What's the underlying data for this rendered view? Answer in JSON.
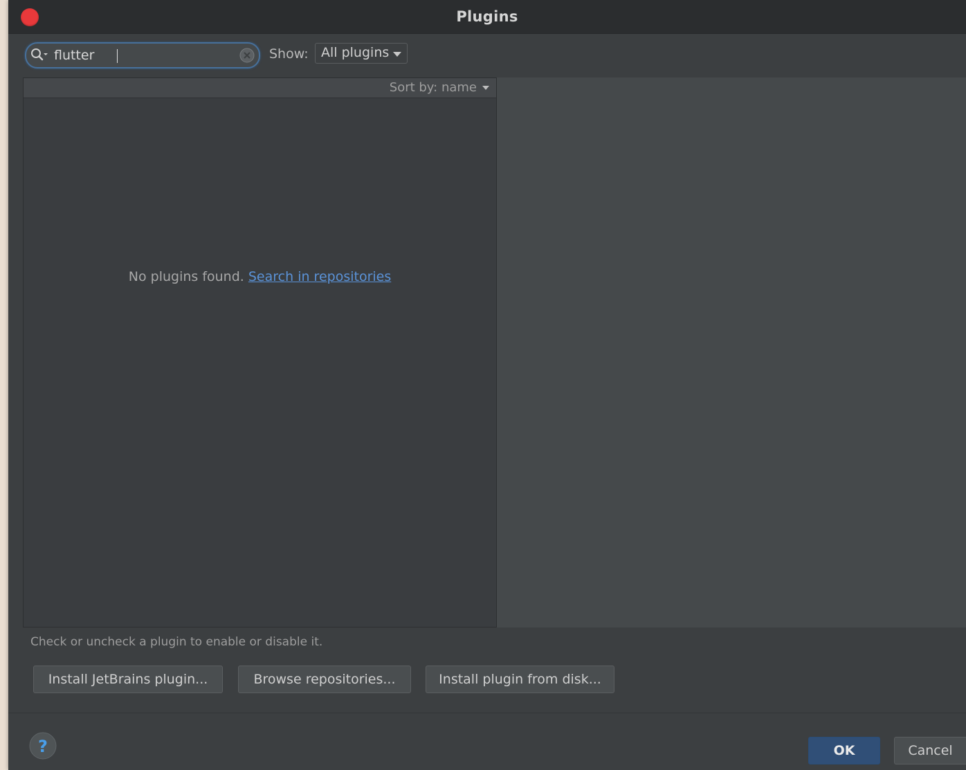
{
  "window": {
    "title": "Plugins"
  },
  "toolbar": {
    "search": {
      "value": "flutter",
      "icon": "search-icon",
      "clear_icon": "clear-icon"
    },
    "show_label": "Show:",
    "show_selected": "All plugins"
  },
  "list": {
    "sort_label": "Sort by: name",
    "empty_message": "No plugins found.",
    "empty_link": "Search in repositories"
  },
  "hint": "Check or uncheck a plugin to enable or disable it.",
  "actions": {
    "install_jetbrains": "Install JetBrains plugin...",
    "browse_repositories": "Browse repositories...",
    "install_from_disk": "Install plugin from disk..."
  },
  "footer": {
    "help_icon": "help-icon",
    "ok": "OK",
    "cancel": "Cancel"
  },
  "colors": {
    "background": "#3c3f41",
    "accent": "#47709b",
    "link": "#5b93d8",
    "close": "#e8393b",
    "ok_button": "#304f77"
  }
}
